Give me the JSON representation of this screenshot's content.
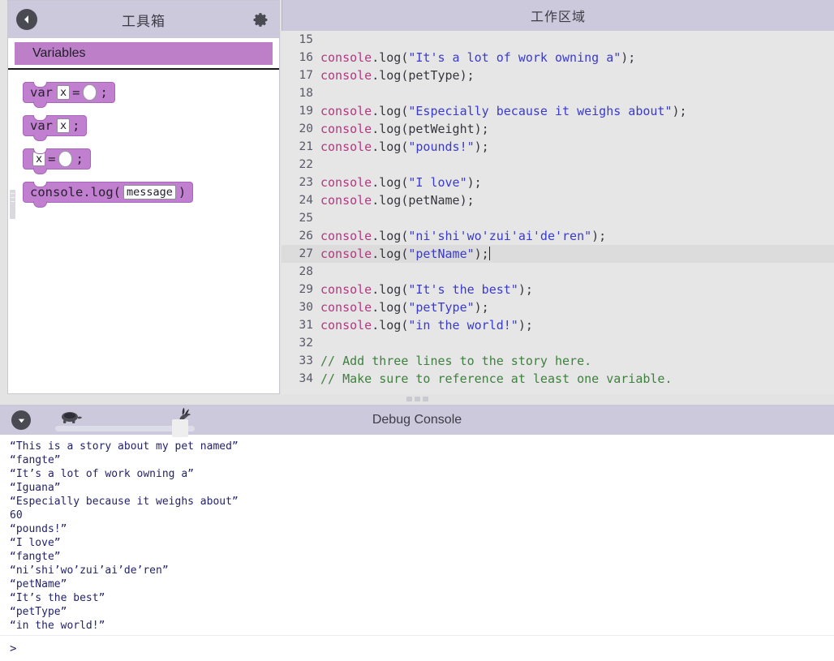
{
  "toolbox": {
    "title": "工具箱",
    "back_icon": "back-arrow-icon",
    "gear_icon": "gear-icon",
    "category": "Variables",
    "blocks": [
      {
        "id": "var-assign",
        "parts": [
          "var",
          "x",
          "=",
          "hole",
          ";"
        ]
      },
      {
        "id": "var-declare",
        "parts": [
          "var",
          "x",
          ";"
        ]
      },
      {
        "id": "assign",
        "parts": [
          "x",
          "=",
          "hole",
          ";"
        ]
      },
      {
        "id": "console-log",
        "parts": [
          "console.log(",
          "message",
          ")"
        ]
      }
    ],
    "block_labels": {
      "var": "var",
      "x": "x",
      "eq": "=",
      "semi": ";",
      "console_log_open": "console.log(",
      "message": "message",
      "close_paren": ")"
    }
  },
  "workspace": {
    "title": "工作区域",
    "first_line_number": 15,
    "active_line": 27,
    "lines": [
      {
        "n": 15,
        "tokens": []
      },
      {
        "n": 16,
        "tokens": [
          {
            "t": "obj",
            "v": "console"
          },
          {
            "t": "dot",
            "v": "."
          },
          {
            "t": "prop",
            "v": "log"
          },
          {
            "t": "punc",
            "v": "("
          },
          {
            "t": "str",
            "v": "\"It's a lot of work owning a\""
          },
          {
            "t": "punc",
            "v": ");"
          }
        ]
      },
      {
        "n": 17,
        "tokens": [
          {
            "t": "obj",
            "v": "console"
          },
          {
            "t": "dot",
            "v": "."
          },
          {
            "t": "prop",
            "v": "log"
          },
          {
            "t": "punc",
            "v": "("
          },
          {
            "t": "id",
            "v": "petType"
          },
          {
            "t": "punc",
            "v": ");"
          }
        ]
      },
      {
        "n": 18,
        "tokens": []
      },
      {
        "n": 19,
        "tokens": [
          {
            "t": "obj",
            "v": "console"
          },
          {
            "t": "dot",
            "v": "."
          },
          {
            "t": "prop",
            "v": "log"
          },
          {
            "t": "punc",
            "v": "("
          },
          {
            "t": "str",
            "v": "\"Especially because it weighs about\""
          },
          {
            "t": "punc",
            "v": ");"
          }
        ]
      },
      {
        "n": 20,
        "tokens": [
          {
            "t": "obj",
            "v": "console"
          },
          {
            "t": "dot",
            "v": "."
          },
          {
            "t": "prop",
            "v": "log"
          },
          {
            "t": "punc",
            "v": "("
          },
          {
            "t": "id",
            "v": "petWeight"
          },
          {
            "t": "punc",
            "v": ");"
          }
        ]
      },
      {
        "n": 21,
        "tokens": [
          {
            "t": "obj",
            "v": "console"
          },
          {
            "t": "dot",
            "v": "."
          },
          {
            "t": "prop",
            "v": "log"
          },
          {
            "t": "punc",
            "v": "("
          },
          {
            "t": "str",
            "v": "\"pounds!\""
          },
          {
            "t": "punc",
            "v": ");"
          }
        ]
      },
      {
        "n": 22,
        "tokens": []
      },
      {
        "n": 23,
        "tokens": [
          {
            "t": "obj",
            "v": "console"
          },
          {
            "t": "dot",
            "v": "."
          },
          {
            "t": "prop",
            "v": "log"
          },
          {
            "t": "punc",
            "v": "("
          },
          {
            "t": "str",
            "v": "\"I love\""
          },
          {
            "t": "punc",
            "v": ");"
          }
        ]
      },
      {
        "n": 24,
        "tokens": [
          {
            "t": "obj",
            "v": "console"
          },
          {
            "t": "dot",
            "v": "."
          },
          {
            "t": "prop",
            "v": "log"
          },
          {
            "t": "punc",
            "v": "("
          },
          {
            "t": "id",
            "v": "petName"
          },
          {
            "t": "punc",
            "v": ");"
          }
        ]
      },
      {
        "n": 25,
        "tokens": []
      },
      {
        "n": 26,
        "tokens": [
          {
            "t": "obj",
            "v": "console"
          },
          {
            "t": "dot",
            "v": "."
          },
          {
            "t": "prop",
            "v": "log"
          },
          {
            "t": "punc",
            "v": "("
          },
          {
            "t": "str",
            "v": "\"ni'shi'wo'zui'ai'de'ren\""
          },
          {
            "t": "punc",
            "v": ");"
          }
        ]
      },
      {
        "n": 27,
        "tokens": [
          {
            "t": "obj",
            "v": "console"
          },
          {
            "t": "dot",
            "v": "."
          },
          {
            "t": "prop",
            "v": "log"
          },
          {
            "t": "punc",
            "v": "("
          },
          {
            "t": "str",
            "v": "\"petName\""
          },
          {
            "t": "punc",
            "v": ");"
          },
          {
            "t": "caret",
            "v": ""
          }
        ]
      },
      {
        "n": 28,
        "tokens": []
      },
      {
        "n": 29,
        "tokens": [
          {
            "t": "obj",
            "v": "console"
          },
          {
            "t": "dot",
            "v": "."
          },
          {
            "t": "prop",
            "v": "log"
          },
          {
            "t": "punc",
            "v": "("
          },
          {
            "t": "str",
            "v": "\"It's the best\""
          },
          {
            "t": "punc",
            "v": ");"
          }
        ]
      },
      {
        "n": 30,
        "tokens": [
          {
            "t": "obj",
            "v": "console"
          },
          {
            "t": "dot",
            "v": "."
          },
          {
            "t": "prop",
            "v": "log"
          },
          {
            "t": "punc",
            "v": "("
          },
          {
            "t": "str",
            "v": "\"petType\""
          },
          {
            "t": "punc",
            "v": ");"
          }
        ]
      },
      {
        "n": 31,
        "tokens": [
          {
            "t": "obj",
            "v": "console"
          },
          {
            "t": "dot",
            "v": "."
          },
          {
            "t": "prop",
            "v": "log"
          },
          {
            "t": "punc",
            "v": "("
          },
          {
            "t": "str",
            "v": "\"in the world!\""
          },
          {
            "t": "punc",
            "v": ");"
          }
        ]
      },
      {
        "n": 32,
        "tokens": []
      },
      {
        "n": 33,
        "tokens": [
          {
            "t": "com",
            "v": "// Add three lines to the story here."
          }
        ]
      },
      {
        "n": 34,
        "tokens": [
          {
            "t": "com",
            "v": "// Make sure to reference at least one variable."
          }
        ]
      }
    ]
  },
  "debug_console": {
    "title": "Debug Console",
    "collapse_icon": "chevron-down-icon",
    "slow_icon": "turtle-icon",
    "fast_icon": "rabbit-icon",
    "speed_value": 100,
    "prompt": ">",
    "output": [
      "“This is a story about my pet named”",
      "“fangte”",
      "“It’s a lot of work owning a”",
      "“Iguana”",
      "“Especially because it weighs about”",
      "60",
      "“pounds!”",
      "“I love”",
      "“fangte”",
      "“ni’shi’wo’zui’ai’de’ren”",
      "“petName”",
      "“It’s the best”",
      "“petType”",
      "“in the world!”"
    ]
  },
  "colors": {
    "header_bar": "#cdc9dd",
    "block_purple": "#c07fcf",
    "category_purple": "#bc7fc8",
    "editor_bg": "#e6e6e6",
    "active_line": "#dcdcdc",
    "string_blue": "#3a3acc",
    "object_pink": "#b0397f",
    "comment_green": "#3f7f3f",
    "console_text": "#23236b"
  }
}
